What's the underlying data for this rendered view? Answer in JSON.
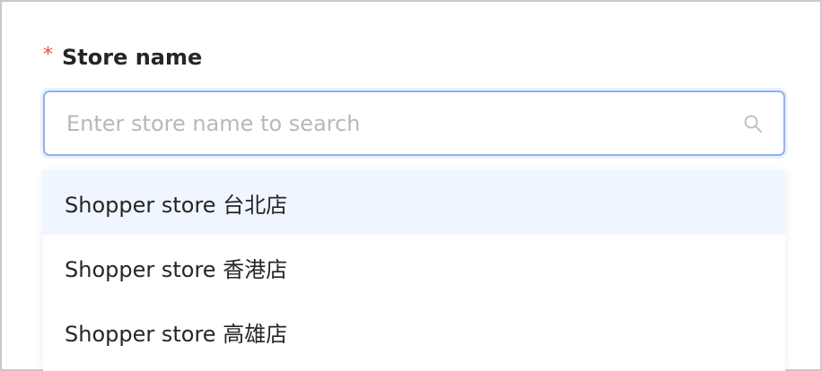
{
  "field": {
    "required_mark": "*",
    "label": "Store name"
  },
  "search": {
    "placeholder": "Enter store name to search",
    "value": "",
    "icon": "search-icon"
  },
  "dropdown": {
    "options": [
      {
        "label": "Shopper store 台北店",
        "active": true
      },
      {
        "label": "Shopper store 香港店",
        "active": false
      },
      {
        "label": "Shopper store 高雄店",
        "active": false
      }
    ]
  },
  "colors": {
    "accent": "#8fb2ef",
    "active_bg": "#f0f6ff",
    "required": "#e8504f",
    "text": "#262626",
    "placeholder": "#b5b8bf"
  }
}
